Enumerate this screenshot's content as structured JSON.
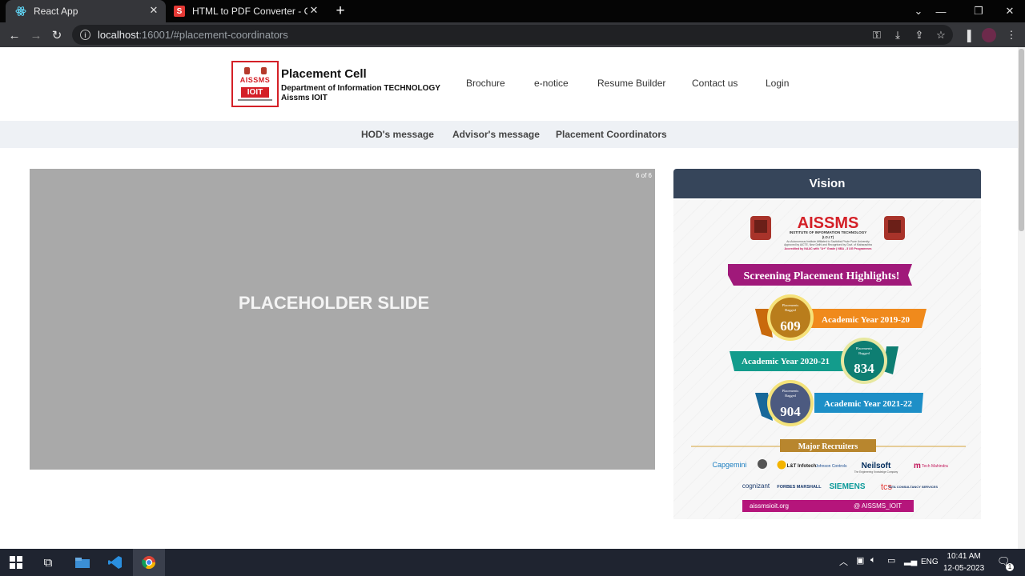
{
  "browser": {
    "tabs": [
      {
        "title": "React App",
        "active": true,
        "icon": "react-icon"
      },
      {
        "title": "HTML to PDF Converter - Conver",
        "active": false,
        "icon": "s-icon"
      }
    ],
    "url_host": "localhost",
    "url_rest": ":16001/#placement-coordinators"
  },
  "header": {
    "logo_text": "AISSMS",
    "logo_sub": "IOIT",
    "title": "Placement Cell",
    "subtitle_line1": "Department of Information TECHNOLOGY",
    "subtitle_line2": "Aissms IOIT",
    "nav": [
      "Brochure",
      "e-notice",
      "Resume Builder",
      "Contact us",
      "Login"
    ]
  },
  "subnav": [
    "HOD's message",
    "Advisor's message",
    "Placement Coordinators"
  ],
  "slider": {
    "counter": "6 of 6",
    "text": "PLACEHOLDER SLIDE"
  },
  "vision": {
    "heading": "Vision",
    "poster": {
      "brand": "AISSMS",
      "brand_sub": "INSTITUTE OF INFORMATION TECHNOLOGY",
      "brand_abbr": "(I.O.I.T)",
      "affil_1": "An Autonomous Institute Affiliated to Savitribai Phule Pune University",
      "affil_2": "Approved by AICTE, New Delhi and Recognised by Govt. of Maharashtra",
      "affil_3": "Accredited by NAAC with \"A+\" Grade | NBA - 3 UG Programmes",
      "banner": "Screening Placement Highlights!",
      "placements_label_1": "Placements",
      "placements_label_2": "Bagged",
      "highlights": [
        {
          "count": "609",
          "year": "Academic Year 2019-20",
          "color": "#f08a1c"
        },
        {
          "count": "834",
          "year": "Academic Year 2020-21",
          "color": "#139c8c"
        },
        {
          "count": "904",
          "year": "Academic Year 2021-22",
          "color": "#1d8fc7"
        }
      ],
      "recruiters_title": "Major Recruiters",
      "recruiters_row1": [
        "Capgemini",
        "L&T Infotech",
        "Johnson Controls",
        "Neilsoft",
        "Tech Mahindra"
      ],
      "recruiters_row1_tagline": "The Engineering Knowledge Company",
      "recruiters_row2": [
        "cognizant",
        "FORBES MARSHALL",
        "SIEMENS",
        "tcs",
        "TATA CONSULTANCY SERVICES"
      ],
      "footer": "aissmsioit.org",
      "footer_handle": "@ AISSMS_IOIT"
    }
  },
  "taskbar": {
    "lang": "ENG",
    "time": "10:41 AM",
    "date": "12-05-2023",
    "notifications": "1"
  }
}
